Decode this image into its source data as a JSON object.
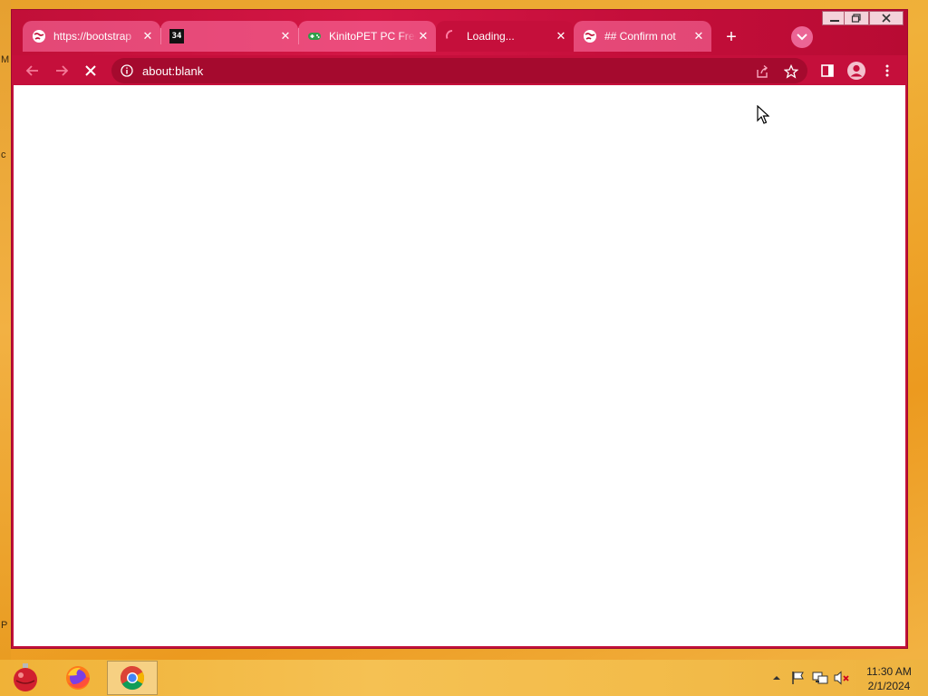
{
  "browser": {
    "tabs": [
      {
        "title": "https://bootstrap",
        "favicon": "globe-icon",
        "state": "inactive"
      },
      {
        "title": "",
        "favicon": "site-34-icon",
        "state": "inactive"
      },
      {
        "title": "KinitoPET PC Free",
        "favicon": "gamepad-icon",
        "state": "inactive"
      },
      {
        "title": "Loading...",
        "favicon": "spinner-icon",
        "state": "active"
      },
      {
        "title": "## Confirm not",
        "favicon": "globe-icon",
        "state": "inactive"
      }
    ],
    "favicon_34_text": "34",
    "close_glyph": "✕",
    "new_tab_glyph": "+",
    "address_bar": {
      "url": "about:blank"
    },
    "accent_color": "#c50f3b"
  },
  "taskbar": {
    "apps": [
      "ornament-icon",
      "firefox-icon",
      "chrome-icon"
    ],
    "tray_icons": [
      "show-hidden-icon",
      "flag-icon",
      "network-icon",
      "volume-muted-icon"
    ],
    "clock": {
      "time": "11:30 AM",
      "date": "2/1/2024"
    }
  },
  "desktop": {
    "edge_glyphs": [
      "M",
      "c",
      "P"
    ]
  }
}
